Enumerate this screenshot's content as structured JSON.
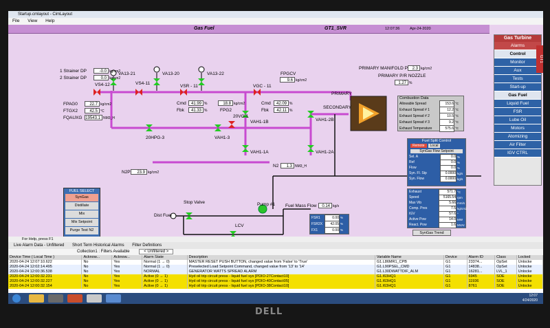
{
  "window": {
    "title": "Startup.cmlayout - CimLayout",
    "menu": [
      "File",
      "View",
      "Help"
    ]
  },
  "header": {
    "title": "Gas Fuel",
    "unit": "GT1_SVR",
    "time": "12:07:36",
    "date": "Apr-24-2020"
  },
  "strainers": [
    {
      "label": "1 Strainer DP",
      "value": "-0.0",
      "unit": "kg/cm2"
    },
    {
      "label": "2 Strainer DP",
      "value": "0.0",
      "unit": "kg/cm2"
    }
  ],
  "valves": {
    "va13_21": "VA13-21",
    "va13_20": "VA13-20",
    "va13_22": "VA13-22",
    "vs4_12": "VS4-12",
    "vs4_11": "VS4-11",
    "vsr11": "VSR - 11",
    "vgc11": "VGC - 11",
    "fpgcv": "FPGCV",
    "vah1_1b": "VAH1-1B",
    "vah1_2b": "VAH1-2B",
    "vah1_1a": "VAH1-1A",
    "vah1_2a": "VAH1-2A",
    "hpg20_3": "20HPG-3",
    "vah1_3": "VAH1-3",
    "vg1_20": "20VG-1"
  },
  "fpag": [
    {
      "label": "FPAG0",
      "value": "22.7",
      "unit": "kg/cm2"
    },
    {
      "label": "FTGX2",
      "value": "42.5",
      "unit": "°C"
    },
    {
      "label": "FQAUXG",
      "value": "19543.1",
      "unit": "NM3_H"
    }
  ],
  "vsr": {
    "cmd_label": "Cmd",
    "cmd": "41.99",
    "fbk_label": "Fbk",
    "fbk": "41.33",
    "unit": "%"
  },
  "fpg2": {
    "value": "18.8",
    "label": "FPG2",
    "unit": "kg/cm2"
  },
  "fpgcv_val": {
    "value": "9.6",
    "unit": "kg/cm2"
  },
  "vgc": {
    "cmd_label": "Cmd",
    "cmd": "42.09",
    "fbk_label": "Fbk",
    "fbk": "42.11",
    "unit": "%"
  },
  "manifold": {
    "label": "PRIMARY MANIFOLD P",
    "value": "2.3",
    "unit": "kg/cm2",
    "pr_label": "PRIMARY P/R NOZZLE",
    "pr_value": "1.27",
    "pr_unit": "%"
  },
  "primary_label": "PRIMARY",
  "secondary_label": "SECONDARY",
  "n2p": {
    "label": "N2P",
    "value": "23.9",
    "unit": "kg/cm2"
  },
  "n2": {
    "label": "N2",
    "value": "1.3",
    "unit": "NM3_H"
  },
  "combustion": {
    "title": "Combustion Data",
    "rows": [
      {
        "label": "Allowable Spread",
        "value": "153.6",
        "unit": "°C"
      },
      {
        "label": "Exhaust Spread # 1",
        "value": "12.2",
        "unit": "°C"
      },
      {
        "label": "Exhaust Spread # 2",
        "value": "10.5",
        "unit": "°C"
      },
      {
        "label": "Exhaust Spread # 3",
        "value": "9.2",
        "unit": "°C"
      },
      {
        "label": "Exhaust Temperature",
        "value": "575.6",
        "unit": "°C"
      }
    ]
  },
  "fuelsplit": {
    "title": "Fuel Split Control",
    "remote": "Remote",
    "local": "Local",
    "syngas_sp": "SynGas Flow Setpoint",
    "rows": [
      {
        "label": "Sel. A",
        "value": "0.0",
        "unit": "%"
      },
      {
        "label": "Ref",
        "value": "0.0",
        "unit": "%"
      },
      {
        "label": "Flow",
        "value": "0.0",
        "unit": "%"
      },
      {
        "label": "Syn. Fl. Stp",
        "value": "0.0000",
        "unit": "kg/s"
      },
      {
        "label": "Syn. Flow",
        "value": "0.0000",
        "unit": "kg/s"
      }
    ]
  },
  "perf": {
    "rows": [
      {
        "label": "Exhaust",
        "value": "571.7",
        "unit": "°C"
      },
      {
        "label": "Speed",
        "value": "5165.54",
        "unit": "rpm"
      },
      {
        "label": "Max Vib",
        "value": "5.66",
        "unit": "mm/s"
      },
      {
        "label": "Comp. Pres",
        "value": "7.5",
        "unit": "kg/cm2"
      },
      {
        "label": "IGV",
        "value": "57.6",
        "unit": "°"
      },
      {
        "label": "Active Pow",
        "value": "14.0",
        "unit": "MW"
      },
      {
        "label": "React. Pow",
        "value": "1.6",
        "unit": "MVAr"
      }
    ],
    "trend_button": "SynGas Trend"
  },
  "fuel_select": {
    "title": "FUEL SELECT",
    "buttons": [
      "SynGas",
      "Distillate",
      "Mix",
      "Mix Setpoint",
      "Purge Test N2"
    ]
  },
  "lower": {
    "stop_valve": "Stop Valve",
    "dist_fuel": "Dist Fuel",
    "pump": "Pump #1",
    "lcv": "LCV",
    "mass_flow_label": "Fuel Mass Flow",
    "mass_flow": "0.14",
    "mass_flow_unit": "kg/s",
    "fsr": [
      {
        "label": "FSR1",
        "value": "0.00",
        "unit": "%"
      },
      {
        "label": "FSR2X",
        "value": "42.05",
        "unit": "%"
      },
      {
        "label": "FX1",
        "value": "0.00",
        "unit": "%"
      }
    ]
  },
  "nav": {
    "title": "Gas Turbine",
    "items": [
      {
        "label": "Alarms",
        "style": "red"
      },
      {
        "label": "Control",
        "style": "light"
      },
      {
        "label": "Monitor",
        "style": "blue"
      },
      {
        "label": "Aux",
        "style": "blue"
      },
      {
        "label": "Tests",
        "style": "blue"
      },
      {
        "label": "Start-up",
        "style": "blue"
      },
      {
        "label": "Gas Fuel",
        "style": "light"
      },
      {
        "label": "Liquid Fuel",
        "style": "blue"
      },
      {
        "label": "FSR",
        "style": "blue"
      },
      {
        "label": "Lube Oil",
        "style": "blue"
      },
      {
        "label": "Motors",
        "style": "blue"
      },
      {
        "label": "Atomizing",
        "style": "blue"
      },
      {
        "label": "Air Filter",
        "style": "blue"
      },
      {
        "label": "IGV CTRL",
        "style": "blue"
      }
    ],
    "side_tab": "GT1"
  },
  "alarms": {
    "help": "For Help, press F1",
    "tabs": [
      "Live Alarm Data - Unfiltered",
      "Short Term Historical Alarms",
      "Filter Definitions"
    ],
    "toolbar": {
      "collection": "Collection1 : Filters Available",
      "filter": "< Unfiltered >"
    },
    "columns": [
      "Device Time ( Local Time )",
      "Acknow...",
      "Acknow...",
      "Alarm State",
      "Description",
      "Variable Name",
      "Device",
      "Alarm ID",
      "Class",
      "Locked"
    ],
    "rows": [
      {
        "cls": "r0",
        "cells": [
          "2020-04-24 12:07:10.622",
          "No",
          "Yes",
          "Normal (1 → 0)",
          "MASTER RESET PUSH BUTTON,  changed value from 'False' to 'True'",
          "G1.L86MR1_CPB",
          "G1",
          "23374...",
          "OpSet",
          "Unlocke"
        ]
      },
      {
        "cls": "r1",
        "cells": [
          "2020-04-24 12:02:14.495",
          "No",
          "Yes",
          "Normal (1 → 0)",
          "Preselected Load Setpoint Command,  changed value from '13' to '14'",
          "G1.L90PSEL_CMD",
          "G1",
          "14838...",
          "OpSet",
          "Unlocke"
        ]
      },
      {
        "cls": "r1",
        "cells": [
          "2020-04-24 12:00:36.538",
          "No",
          "Yes",
          "NORMAL",
          "GENERATOR WATTS SPREAD ALARM",
          "G1.L30DWATTDIF_ALM",
          "G1",
          "16281...",
          "LVL_1",
          "Unlocke"
        ]
      },
      {
        "cls": "r3",
        "cells": [
          "2020-04-24 12:00:32.231",
          "No",
          "Yes",
          "Active (0 → 1)",
          "Hyd oil trip circuit press - liquid fuel sys [PDIO-27Contact10]",
          "G1.I63HQ1",
          "G1",
          "6945",
          "SOE",
          "Unlocke"
        ]
      },
      {
        "cls": "r3",
        "cells": [
          "2020-04-24 12:00:32.227",
          "No",
          "Yes",
          "Active (0 → 1)",
          "Hyd oil trip circuit press - liquid fuel sys [PDIO-40Contact05]",
          "G1.I63HQ1",
          "G1",
          "11936",
          "SOE",
          "Unlocke"
        ]
      },
      {
        "cls": "r3",
        "cells": [
          "2020-04-24 12:00:32.154",
          "No",
          "Yes",
          "Active (0 → 1)",
          "Hyd oil trip circuit press - liquid fuel sys [PDIO-38Contact10]",
          "G1.I63HQ1",
          "G1",
          "8761",
          "SOE",
          "Unlocke"
        ]
      }
    ]
  },
  "taskbar": {
    "time": "12:07",
    "date": "4/24/2020"
  },
  "brand": "DELL"
}
